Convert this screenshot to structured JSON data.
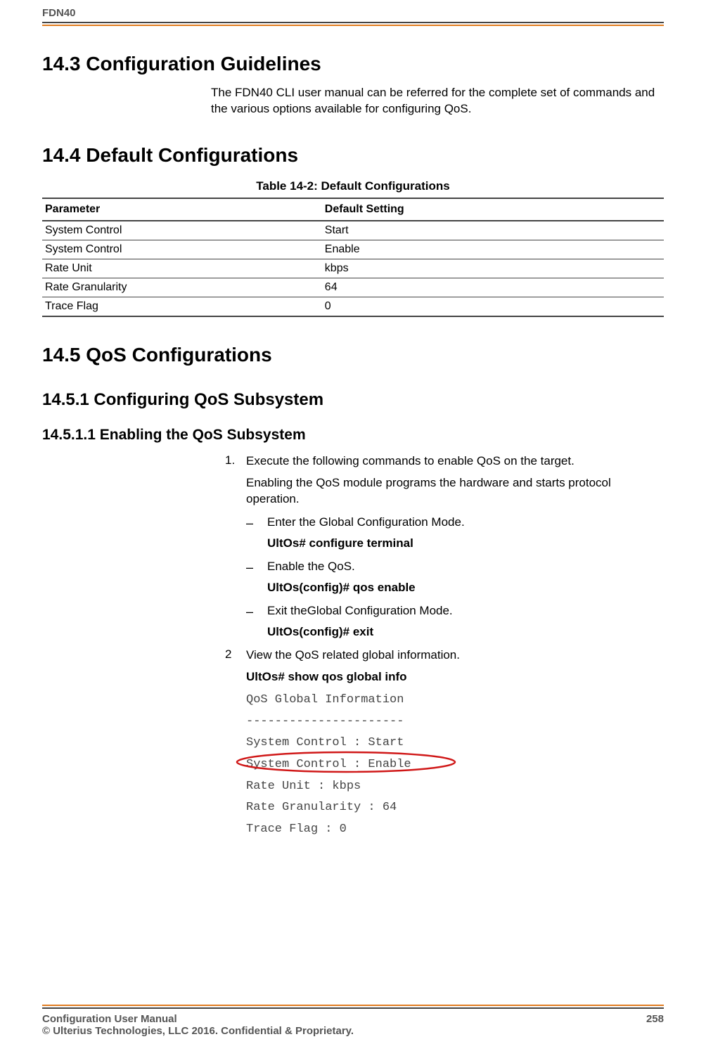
{
  "header": {
    "product": "FDN40"
  },
  "section_14_3": {
    "title": "14.3 Configuration Guidelines",
    "text": "The FDN40 CLI user manual can be referred for the complete set of commands and the various options available for configuring QoS."
  },
  "section_14_4": {
    "title": "14.4 Default Configurations",
    "table_caption": "Table 14-2: Default Configurations",
    "col_parameter": "Parameter",
    "col_default": "Default Setting",
    "rows": [
      {
        "param": "System Control",
        "value": "Start"
      },
      {
        "param": "System Control",
        "value": "Enable"
      },
      {
        "param": "Rate Unit",
        "value": "kbps"
      },
      {
        "param": "Rate Granularity",
        "value": "64"
      },
      {
        "param": "Trace Flag",
        "value": "0"
      }
    ]
  },
  "section_14_5": {
    "title": "14.5 QoS Configurations",
    "sub1": {
      "title": "14.5.1   Configuring QoS Subsystem",
      "sub11": {
        "title": "14.5.1.1   Enabling the QoS Subsystem",
        "step1_no": "1.",
        "step1_text": "Execute the following commands to enable QoS on the target.",
        "step1_desc": "Enabling the QoS module programs the hardware and starts protocol operation.",
        "b1": "Enter the Global Configuration Mode.",
        "c1": "UltOs# configure terminal",
        "b2": "Enable the QoS.",
        "c2": "UltOs(config)# qos enable",
        "b3": "Exit theGlobal Configuration Mode.",
        "c3": "UltOs(config)# exit",
        "step2_no": "2",
        "step2_text": "View the QoS related global information.",
        "c4": "UltOs# show qos global info",
        "out1": "QoS Global Information",
        "out2": "----------------------",
        "out3": "System Control : Start",
        "out4": "System Control : Enable",
        "out5": "Rate Unit : kbps",
        "out6": "Rate Granularity : 64",
        "out7": "Trace Flag : 0"
      }
    }
  },
  "footer": {
    "manual": "Configuration User Manual",
    "page": "258",
    "copyright": "© Ulterius Technologies, LLC 2016. Confidential & Proprietary."
  },
  "colors": {
    "accent": "#e07b1f",
    "annotation": "#d01818"
  }
}
